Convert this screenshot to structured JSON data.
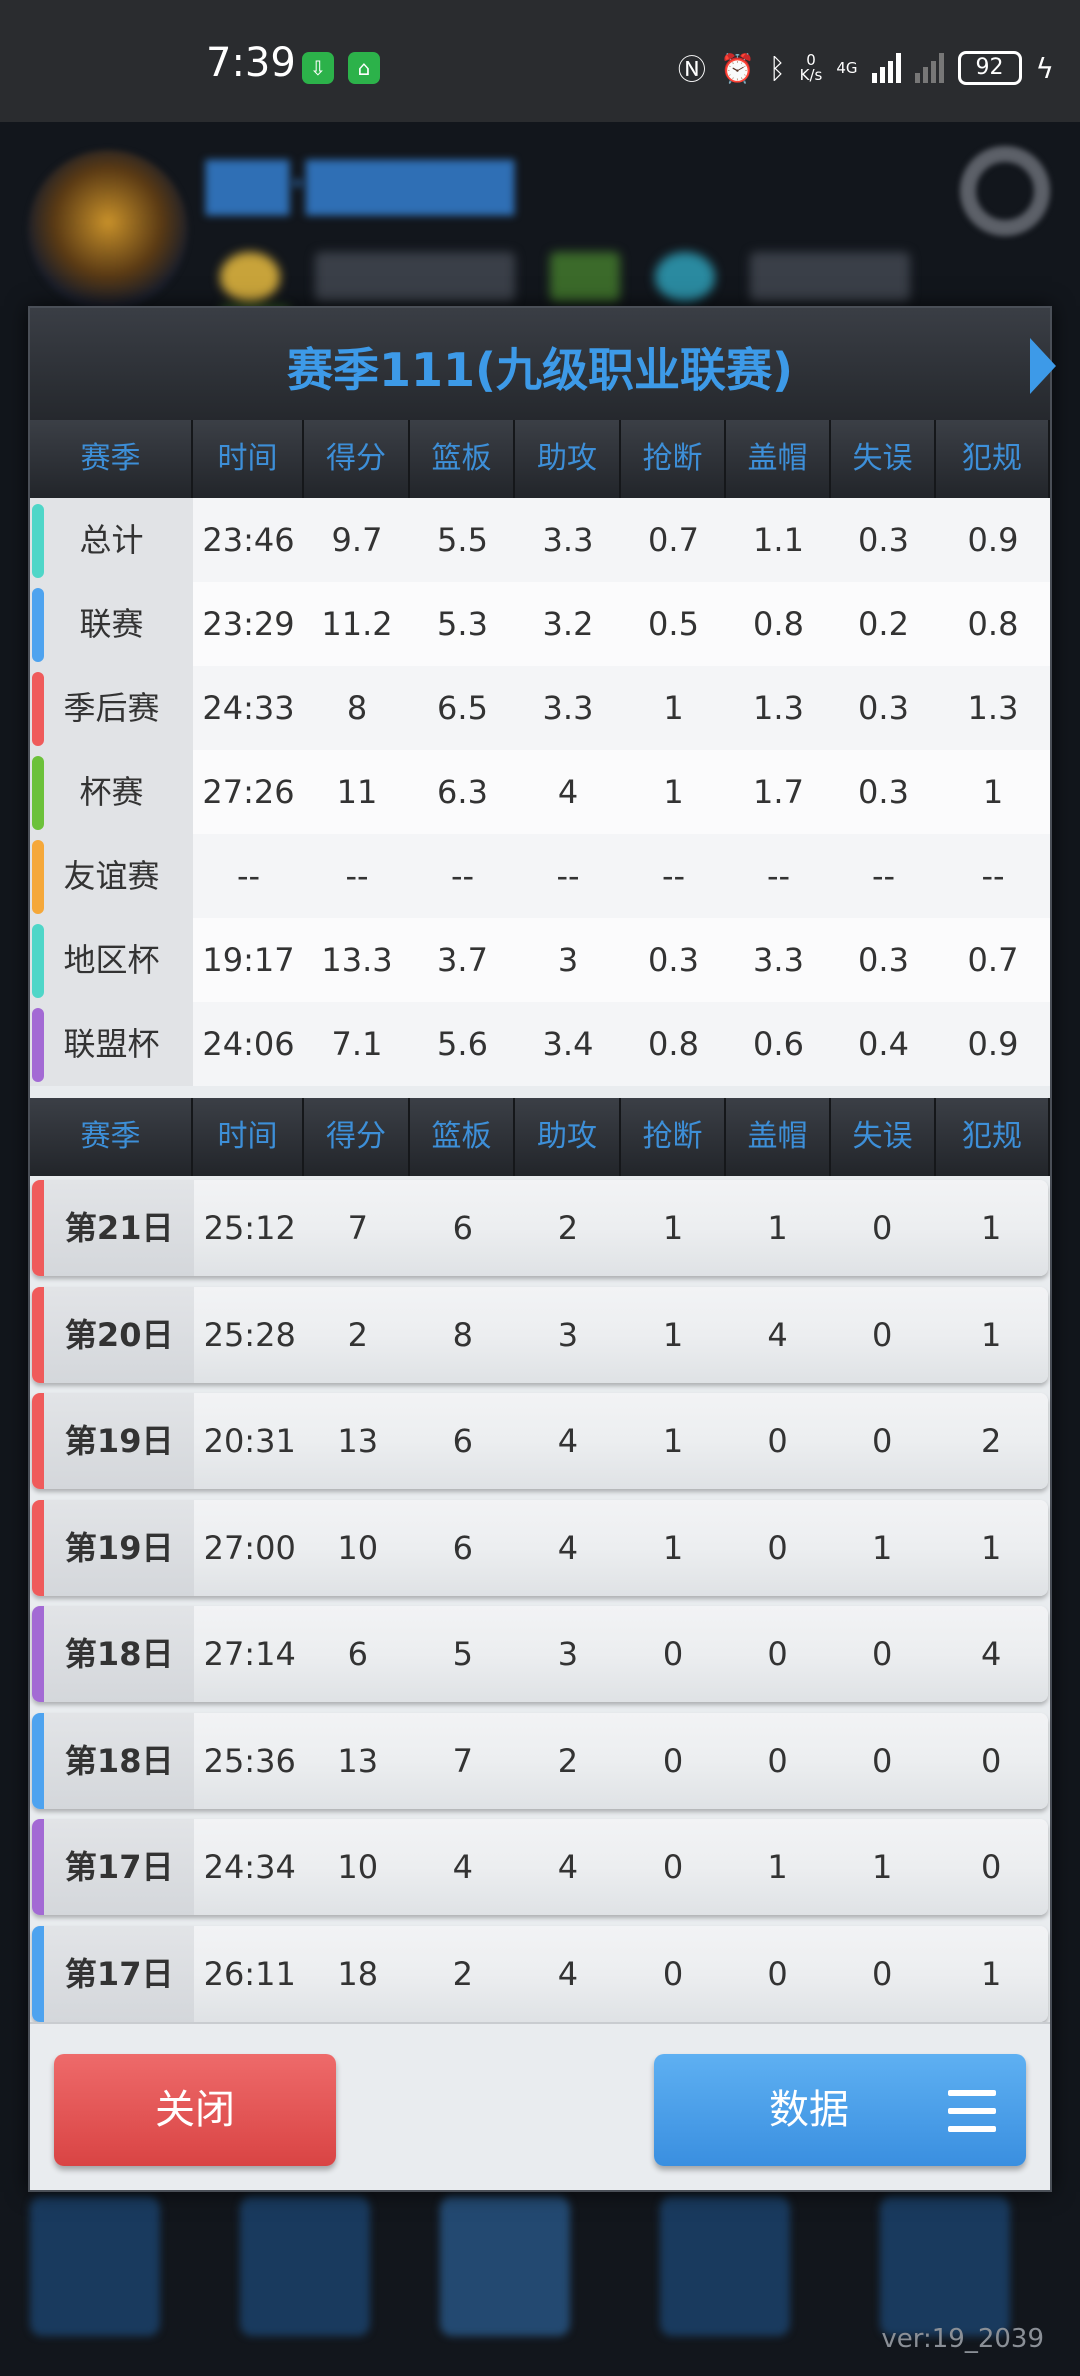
{
  "status_bar": {
    "time": "7:39",
    "net_speed_top": "0",
    "net_speed_bottom": "K/s",
    "network_type": "4G",
    "battery": "92",
    "icons": [
      "nfc-icon",
      "alarm-icon",
      "bluetooth-icon",
      "signal-icon",
      "battery-icon",
      "charging-icon"
    ]
  },
  "dialog": {
    "title": "赛季111(九级职业联赛)",
    "columns": [
      "赛季",
      "时间",
      "得分",
      "篮板",
      "助攻",
      "抢断",
      "盖帽",
      "失误",
      "犯规"
    ],
    "summary_rows": [
      {
        "label": "总计",
        "color": "#4fd6c8",
        "values": [
          "23:46",
          "9.7",
          "5.5",
          "3.3",
          "0.7",
          "1.1",
          "0.3",
          "0.9"
        ]
      },
      {
        "label": "联赛",
        "color": "#4ea3ef",
        "values": [
          "23:29",
          "11.2",
          "5.3",
          "3.2",
          "0.5",
          "0.8",
          "0.2",
          "0.8"
        ]
      },
      {
        "label": "季后赛",
        "color": "#ef5b5b",
        "values": [
          "24:33",
          "8",
          "6.5",
          "3.3",
          "1",
          "1.3",
          "0.3",
          "1.3"
        ]
      },
      {
        "label": "杯赛",
        "color": "#6cc13a",
        "values": [
          "27:26",
          "11",
          "6.3",
          "4",
          "1",
          "1.7",
          "0.3",
          "1"
        ]
      },
      {
        "label": "友谊赛",
        "color": "#f5a83a",
        "values": [
          "--",
          "--",
          "--",
          "--",
          "--",
          "--",
          "--",
          "--"
        ]
      },
      {
        "label": "地区杯",
        "color": "#4fd6c8",
        "values": [
          "19:17",
          "13.3",
          "3.7",
          "3",
          "0.3",
          "3.3",
          "0.3",
          "0.7"
        ]
      },
      {
        "label": "联盟杯",
        "color": "#a36ad4",
        "values": [
          "24:06",
          "7.1",
          "5.6",
          "3.4",
          "0.8",
          "0.6",
          "0.4",
          "0.9"
        ]
      }
    ],
    "game_rows": [
      {
        "label": "第21日",
        "color": "#ef5b5b",
        "values": [
          "25:12",
          "7",
          "6",
          "2",
          "1",
          "1",
          "0",
          "1"
        ]
      },
      {
        "label": "第20日",
        "color": "#ef5b5b",
        "values": [
          "25:28",
          "2",
          "8",
          "3",
          "1",
          "4",
          "0",
          "1"
        ]
      },
      {
        "label": "第19日",
        "color": "#ef5b5b",
        "values": [
          "20:31",
          "13",
          "6",
          "4",
          "1",
          "0",
          "0",
          "2"
        ]
      },
      {
        "label": "第19日",
        "color": "#ef5b5b",
        "values": [
          "27:00",
          "10",
          "6",
          "4",
          "1",
          "0",
          "1",
          "1"
        ]
      },
      {
        "label": "第18日",
        "color": "#a36ad4",
        "values": [
          "27:14",
          "6",
          "5",
          "3",
          "0",
          "0",
          "0",
          "4"
        ]
      },
      {
        "label": "第18日",
        "color": "#4ea3ef",
        "values": [
          "25:36",
          "13",
          "7",
          "2",
          "0",
          "0",
          "0",
          "0"
        ]
      },
      {
        "label": "第17日",
        "color": "#a36ad4",
        "values": [
          "24:34",
          "10",
          "4",
          "4",
          "0",
          "1",
          "1",
          "0"
        ]
      },
      {
        "label": "第17日",
        "color": "#4ea3ef",
        "values": [
          "26:11",
          "18",
          "2",
          "4",
          "0",
          "0",
          "0",
          "1"
        ]
      }
    ],
    "close_label": "关闭",
    "data_label": "数据"
  },
  "version": "ver:19_2039"
}
